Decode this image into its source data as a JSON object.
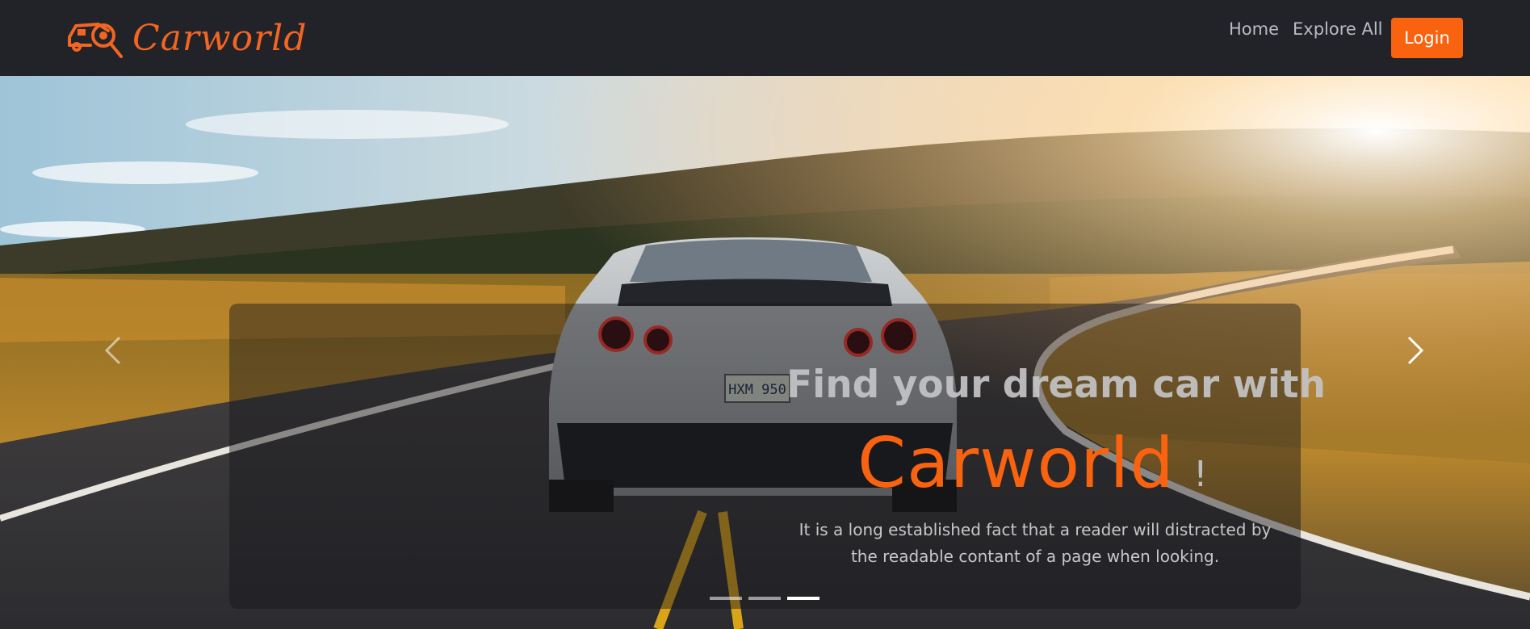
{
  "navbar": {
    "brand_name": "Carworld",
    "brand_icon": "car-search-logo-icon",
    "links": [
      {
        "label": "Home"
      },
      {
        "label": "Explore All"
      }
    ],
    "login_label": "Login"
  },
  "hero": {
    "headline": "Find your dream car with",
    "brand": "Carworld",
    "exclaim": "!",
    "subtext": "It is a long established fact that a reader will distracted by the readable contant of a page when looking.",
    "prev_icon": "chevron-left-icon",
    "next_icon": "chevron-right-icon",
    "indicators": [
      {
        "active": false
      },
      {
        "active": false
      },
      {
        "active": true
      }
    ],
    "license_plate": "HXM 950"
  },
  "colors": {
    "navbar_bg": "#212329",
    "accent": "#f9620f",
    "nav_text": "#b9bcc2"
  }
}
